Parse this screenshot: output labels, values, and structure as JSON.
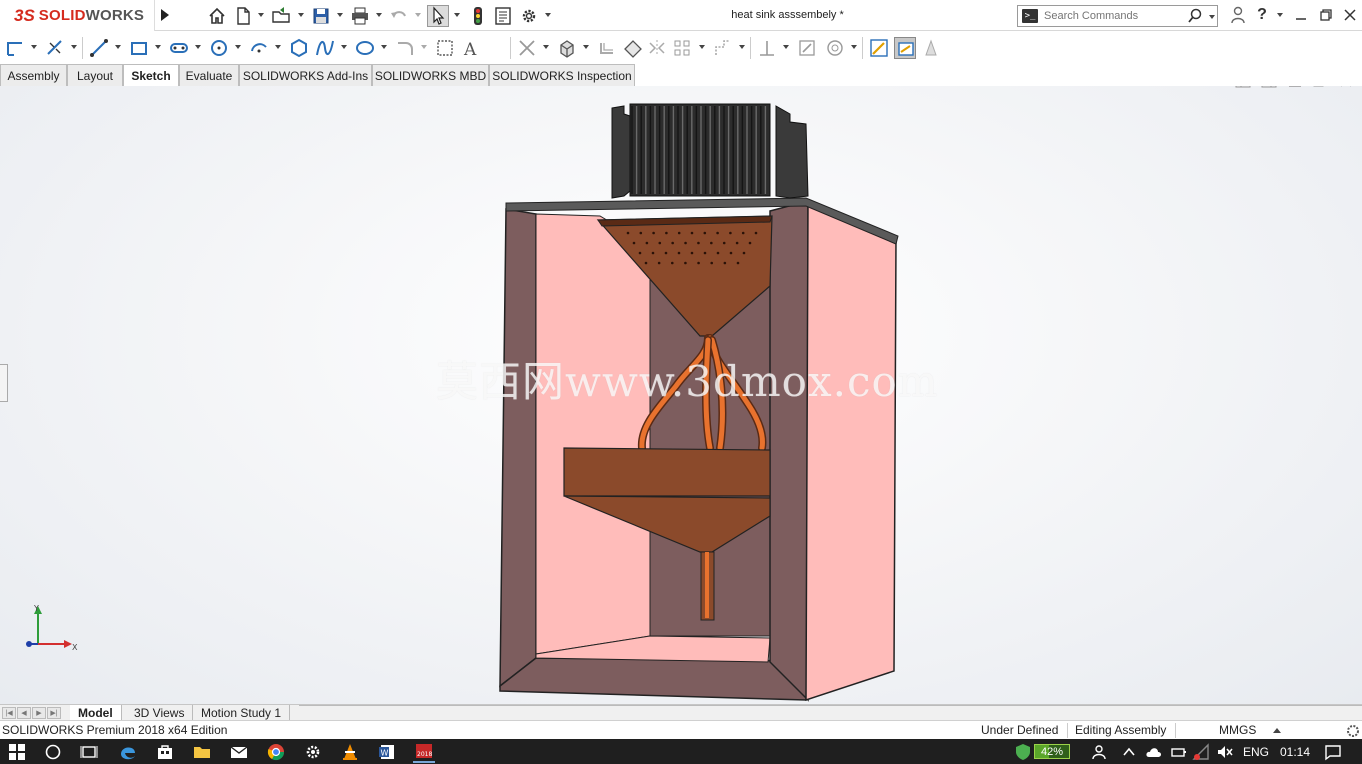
{
  "app": {
    "brand_ds": "3S",
    "brand_solid": "SOLID",
    "brand_works": "WORKS",
    "document_title": "heat sink asssembely *"
  },
  "search": {
    "placeholder": "Search Commands"
  },
  "tabs": [
    {
      "label": "Assembly",
      "active": false
    },
    {
      "label": "Layout",
      "active": false
    },
    {
      "label": "Sketch",
      "active": true
    },
    {
      "label": "Evaluate",
      "active": false
    },
    {
      "label": "SOLIDWORKS Add-Ins",
      "active": false
    },
    {
      "label": "SOLIDWORKS MBD",
      "active": false
    },
    {
      "label": "SOLIDWORKS Inspection",
      "active": false
    }
  ],
  "viewport": {
    "watermark": "莫西网www.3dmox.com",
    "triad_y": "Y",
    "triad_x": "X",
    "colors": {
      "box_outer": "#7d5d5e",
      "box_inner": "#ffbcba",
      "copper": "#8b4a2b",
      "copper_light": "#e8722e",
      "heatsink": "#2c2c2c"
    }
  },
  "bottom_tabs": [
    {
      "label": "Model",
      "active": true
    },
    {
      "label": "3D Views",
      "active": false
    },
    {
      "label": "Motion Study 1",
      "active": false
    }
  ],
  "status": {
    "edition": "SOLIDWORKS Premium 2018 x64 Edition",
    "definition": "Under Defined",
    "mode": "Editing Assembly",
    "units": "MMGS"
  },
  "taskbar": {
    "battery_percent": "42%",
    "battery_level": 0.42,
    "language": "ENG",
    "time": "01:14",
    "solidworks_badge": "2018"
  }
}
